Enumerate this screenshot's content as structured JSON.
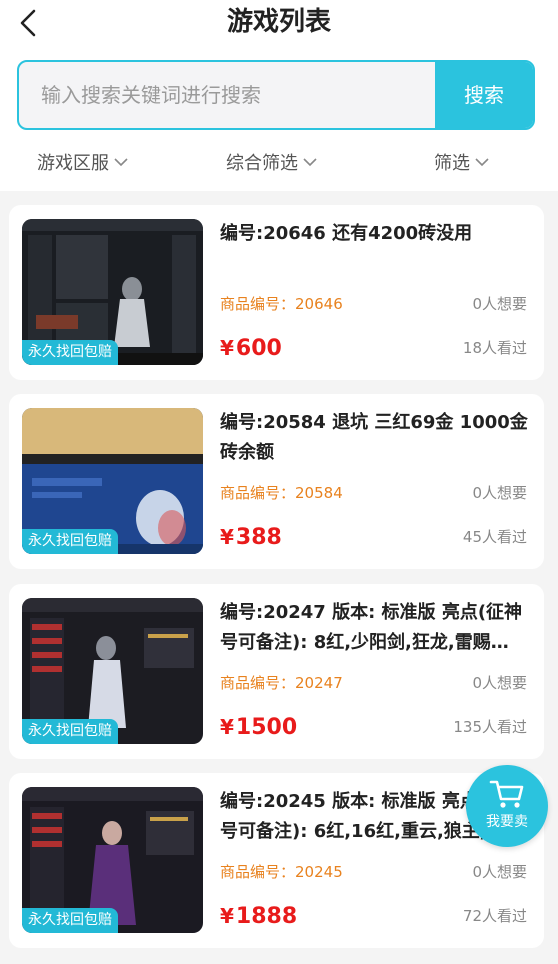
{
  "header": {
    "title": "游戏列表",
    "back_icon": "chevron-left-icon"
  },
  "search": {
    "placeholder": "输入搜索关键词进行搜索",
    "button_label": "搜索"
  },
  "filters": [
    {
      "label": "游戏区服",
      "icon": "chevron-down-icon"
    },
    {
      "label": "综合筛选",
      "icon": "chevron-down-icon"
    },
    {
      "label": "筛选",
      "icon": "chevron-down-icon"
    }
  ],
  "items": [
    {
      "title": "编号:20646 还有4200砖没用",
      "code_label": "商品编号：",
      "code": "20646",
      "want": "0人想要",
      "price": "600",
      "views": "18人看过",
      "badge": "永久找回包赔"
    },
    {
      "title": "编号:20584 退坑 三红69金 1000金砖余额",
      "code_label": "商品编号：",
      "code": "20584",
      "want": "0人想要",
      "price": "388",
      "views": "45人看过",
      "badge": "永久找回包赔"
    },
    {
      "title": "编号:20247 版本: 标准版 亮点(征神号可备注): 8红,少阳剑,狂龙,雷赐…",
      "code_label": "商品编号：",
      "code": "20247",
      "want": "0人想要",
      "price": "1500",
      "views": "135人看过",
      "badge": "永久找回包赔"
    },
    {
      "title": "编号:20245 版本: 标准版 亮点(征神号可备注): 6红,16红,重云,狼主,",
      "code_label": "商品编号：",
      "code": "20245",
      "want": "0人想要",
      "price": "1888",
      "views": "72人看过",
      "badge": "永久找回包赔"
    }
  ],
  "currency_symbol": "¥",
  "sell_fab": {
    "label": "我要卖",
    "icon": "cart-icon"
  },
  "colors": {
    "accent": "#2bc3de",
    "price": "#e81b1b",
    "code": "#e8821f"
  }
}
